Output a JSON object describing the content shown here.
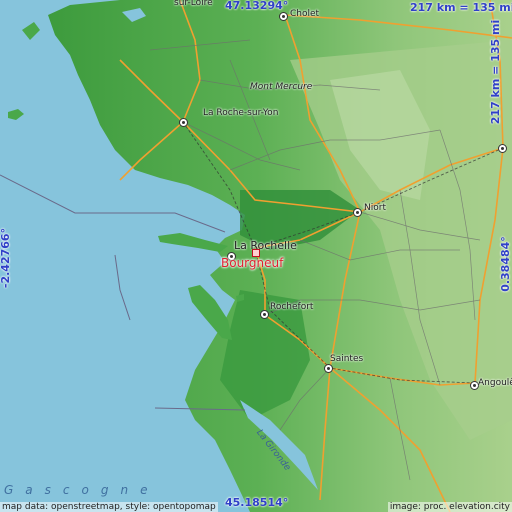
{
  "map": {
    "top_latitude": "47.13294°",
    "bottom_latitude": "45.18514°",
    "left_longitude": "-2.42766°",
    "right_longitude": "0.38484°",
    "scale_horizontal": "217 km = 135 mi",
    "scale_vertical": "217 km = 135 mi",
    "sea_label": "Gascogne",
    "river_label": "La Gironde",
    "target": {
      "name": "Bourgneuf",
      "color": "#e02030"
    },
    "cities": [
      {
        "id": "sur-loire",
        "name": "sur-Loire"
      },
      {
        "id": "cholet",
        "name": "Cholet"
      },
      {
        "id": "mont-mercure",
        "name": "Mont Mercure"
      },
      {
        "id": "la-roche-sur-yon",
        "name": "La Roche-sur-Yon"
      },
      {
        "id": "niort",
        "name": "Niort"
      },
      {
        "id": "la-rochelle",
        "name": "La Rochelle"
      },
      {
        "id": "rochefort",
        "name": "Rochefort"
      },
      {
        "id": "saintes",
        "name": "Saintes"
      },
      {
        "id": "angouleme",
        "name": "Angoulê"
      }
    ],
    "credits": {
      "left": "map data: openstreetmap, style: opentopomap",
      "right": "image: proc. elevation.city"
    },
    "colors": {
      "sea": "#86c4dc",
      "lowland": "#4aa84a",
      "midland": "#8cc878",
      "highland": "#b8d8a0",
      "roads": "#f0a030"
    }
  }
}
